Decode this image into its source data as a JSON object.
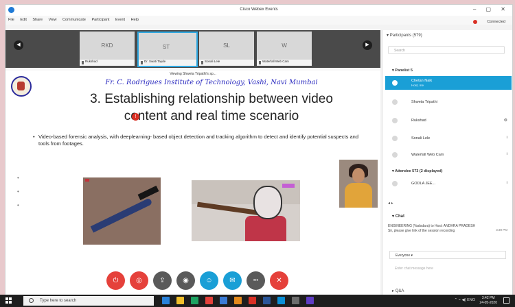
{
  "window": {
    "title": "Cisco Webex Events",
    "controls": "– ▢ ✕"
  },
  "menubar": {
    "items": [
      "File",
      "Edit",
      "Share",
      "View",
      "Communicate",
      "Participant",
      "Event",
      "Help"
    ],
    "connection": "Connected"
  },
  "thumbnails": [
    {
      "initials": "RKD",
      "name": "Rukshad"
    },
    {
      "initials": "ST",
      "name": "Dr. Swati Tayde"
    },
    {
      "initials": "SL",
      "name": "Sonali Lele"
    },
    {
      "initials": "W",
      "name": "Waterfall Web Cam"
    }
  ],
  "slide": {
    "viewing": "Viewing Shweta Tripathi's sp...",
    "college": "Fr. C. Rodrigues Institute of Technology, Vashi, Navi Mumbai",
    "title_line1": "3. Establishing relationship between video",
    "title_line2": "content and real time scenario",
    "bullet": "Video-based forensic analysis, with deeplearning- based object detection and tracking algorithm to detect and identify potential suspects and tools from footages."
  },
  "controls": [
    {
      "name": "mute-button",
      "icon": "mic-off",
      "color": "#e5413b",
      "glyph": "⏻"
    },
    {
      "name": "stop-video-button",
      "icon": "video-off",
      "color": "#e5413b",
      "glyph": "◎"
    },
    {
      "name": "share-button",
      "icon": "share",
      "color": "#5a5a5a",
      "glyph": "⇪"
    },
    {
      "name": "record-button",
      "icon": "record",
      "color": "#5a5a5a",
      "glyph": "◉"
    },
    {
      "name": "participants-button",
      "icon": "participants",
      "color": "#1a9fd6",
      "glyph": "☺"
    },
    {
      "name": "chat-button",
      "icon": "chat",
      "color": "#1a9fd6",
      "glyph": "✉"
    },
    {
      "name": "more-button",
      "icon": "more",
      "color": "#5a5a5a",
      "glyph": "•••"
    },
    {
      "name": "leave-button",
      "icon": "leave",
      "color": "#e5413b",
      "glyph": "✕"
    }
  ],
  "participants": {
    "header": "Participants (579)",
    "search_placeholder": "Search",
    "panelist_heading": "Panelist 5",
    "rows": [
      {
        "name": "Chetan Naik",
        "sub": "Host, me"
      },
      {
        "name": "Shweta Tripathi",
        "sub": ""
      },
      {
        "name": "Rukshad",
        "sub": ""
      },
      {
        "name": "Sonali Lele",
        "sub": ""
      },
      {
        "name": "Waterfall Web Cam",
        "sub": ""
      }
    ],
    "attendee_heading": "Attendee 573 (2 displayed)",
    "attendee_row": "GODLA JEE..."
  },
  "chat": {
    "title": "Chat",
    "sender": "ENGINEERING (Vadodara) to Host: ANDHRA PRADESH",
    "message": "Sir, please give link of the session recording",
    "time": "3:39 PM",
    "to": "Everyone",
    "input_placeholder": "Enter chat message here"
  },
  "qa_label": "Q&A",
  "taskbar": {
    "search_text": "Type here to search",
    "lang": "ENG",
    "time": "3:42 PM",
    "date": "24-05-2020",
    "apps": [
      "#2a82da",
      "#f2c02c",
      "#1ea362",
      "#e5413b",
      "#3a7bd5",
      "#e48a1c",
      "#d93025",
      "#2a5699",
      "#0a8fd6",
      "#6d6d6d",
      "#5f3dc4"
    ]
  }
}
